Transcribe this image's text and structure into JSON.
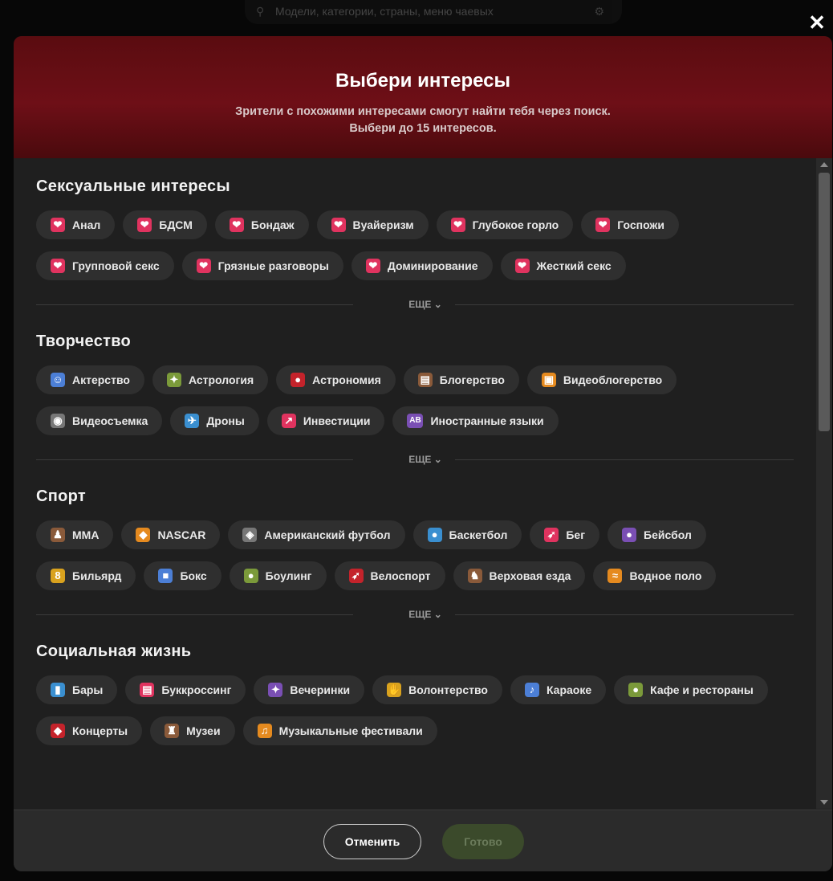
{
  "background": {
    "search_placeholder": "Модели, категории, страны, меню чаевых"
  },
  "modal": {
    "title": "Выбери интересы",
    "subtitle_line1": "Зрители с похожими интересами смогут найти тебя через поиск.",
    "subtitle_line2": "Выбери до 15 интересов."
  },
  "more_label": "ЕЩЕ ⌄",
  "sections": [
    {
      "title": "Сексуальные интересы",
      "chips": [
        {
          "label": "Анал",
          "icon": "❤"
        },
        {
          "label": "БДСМ",
          "icon": "❤"
        },
        {
          "label": "Бондаж",
          "icon": "❤"
        },
        {
          "label": "Вуайеризм",
          "icon": "❤"
        },
        {
          "label": "Глубокое горло",
          "icon": "❤"
        },
        {
          "label": "Госпожи",
          "icon": "❤"
        },
        {
          "label": "Групповой секс",
          "icon": "❤"
        },
        {
          "label": "Грязные разговоры",
          "icon": "❤"
        },
        {
          "label": "Доминирование",
          "icon": "❤"
        },
        {
          "label": "Жесткий секс",
          "icon": "❤"
        }
      ]
    },
    {
      "title": "Творчество",
      "chips": [
        {
          "label": "Актерство",
          "icon": "☺"
        },
        {
          "label": "Астрология",
          "icon": "✦"
        },
        {
          "label": "Астрономия",
          "icon": "●"
        },
        {
          "label": "Блогерство",
          "icon": "▤"
        },
        {
          "label": "Видеоблогерство",
          "icon": "▣"
        },
        {
          "label": "Видеосъемка",
          "icon": "◉"
        },
        {
          "label": "Дроны",
          "icon": "✈"
        },
        {
          "label": "Инвестиции",
          "icon": "↗"
        },
        {
          "label": "Иностранные языки",
          "icon": "AB"
        }
      ]
    },
    {
      "title": "Спорт",
      "chips": [
        {
          "label": "MMA",
          "icon": "♟"
        },
        {
          "label": "NASCAR",
          "icon": "◆"
        },
        {
          "label": "Американский футбол",
          "icon": "◈"
        },
        {
          "label": "Баскетбол",
          "icon": "●"
        },
        {
          "label": "Бег",
          "icon": "➶"
        },
        {
          "label": "Бейсбол",
          "icon": "●"
        },
        {
          "label": "Бильярд",
          "icon": "8"
        },
        {
          "label": "Бокс",
          "icon": "■"
        },
        {
          "label": "Боулинг",
          "icon": "●"
        },
        {
          "label": "Велоспорт",
          "icon": "➶"
        },
        {
          "label": "Верховая езда",
          "icon": "♞"
        },
        {
          "label": "Водное поло",
          "icon": "≈"
        }
      ]
    },
    {
      "title": "Социальная жизнь",
      "chips": [
        {
          "label": "Бары",
          "icon": "▮"
        },
        {
          "label": "Буккроссинг",
          "icon": "▤"
        },
        {
          "label": "Вечеринки",
          "icon": "✦"
        },
        {
          "label": "Волонтерство",
          "icon": "✋"
        },
        {
          "label": "Караоке",
          "icon": "♪"
        },
        {
          "label": "Кафе и рестораны",
          "icon": "●"
        },
        {
          "label": "Концерты",
          "icon": "◆"
        },
        {
          "label": "Музеи",
          "icon": "♜"
        },
        {
          "label": "Музыкальные фестивали",
          "icon": "♫"
        }
      ]
    }
  ],
  "footer": {
    "cancel_label": "Отменить",
    "done_label": "Готово"
  }
}
